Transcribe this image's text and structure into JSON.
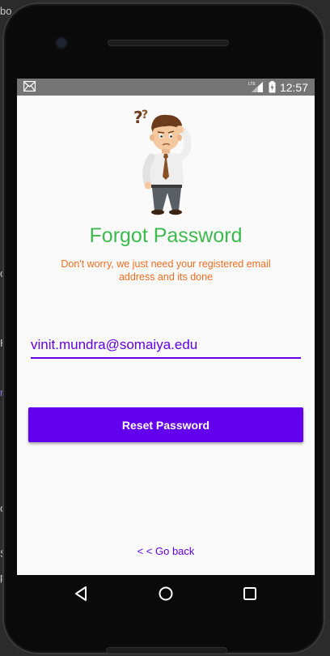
{
  "backdrop": {
    "chars": [
      "bo",
      "o",
      "H",
      "r",
      "o",
      "S",
      "p"
    ]
  },
  "status_bar": {
    "time": "12:57",
    "icons": [
      "gmail-notification-icon",
      "lte-signal-icon",
      "battery-charging-icon"
    ]
  },
  "app": {
    "title": "Forgot Password",
    "subtitle": "Don't worry, we just need your registered email address and its done",
    "email": {
      "value": "vinit.mundra@somaiya.edu",
      "placeholder": ""
    },
    "reset_button_label": "Reset Password",
    "go_back_label": "< < Go back"
  },
  "nav_bar": {
    "buttons": [
      "back-triangle-icon",
      "home-circle-icon",
      "recents-square-icon"
    ]
  },
  "colors": {
    "title": "#3dba4e",
    "subtitle": "#f26d21",
    "accent": "#6200ee",
    "status_bar": "#757575",
    "screen_bg": "#fafafa"
  }
}
